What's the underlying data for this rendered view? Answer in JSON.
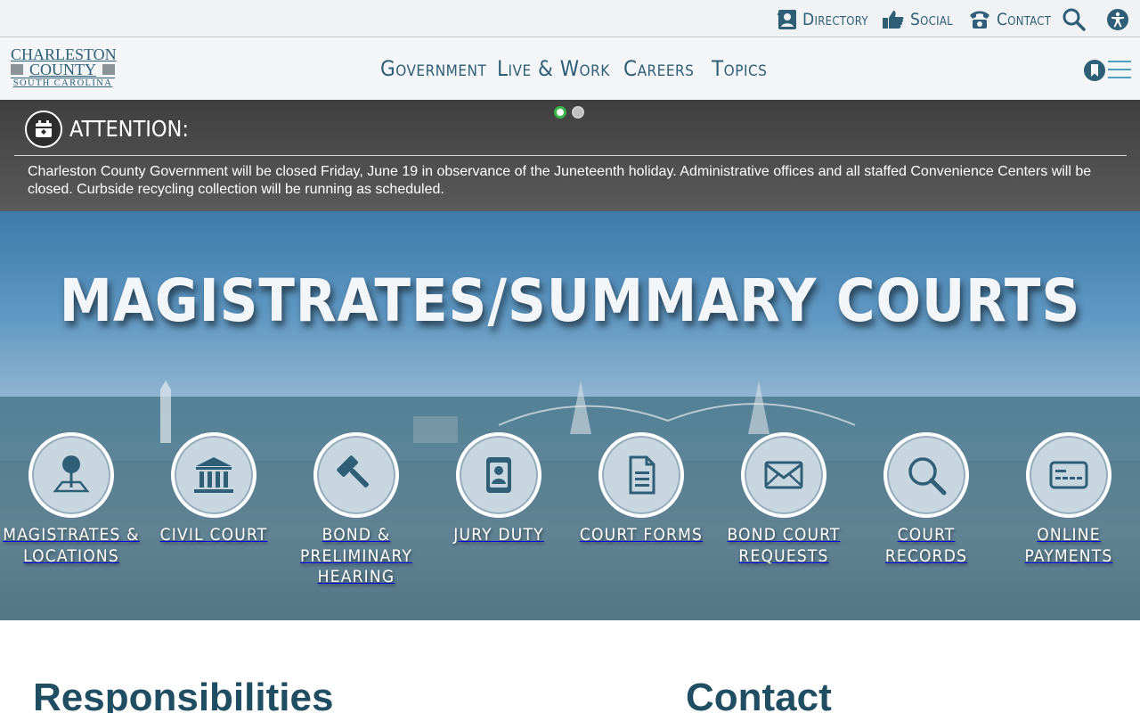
{
  "utility_bar": {
    "directory": "Directory",
    "social": "Social",
    "contact": "Contact"
  },
  "logo": {
    "line1": "CHARLESTON",
    "line2": "COUNTY",
    "line3": "SOUTH CAROLINA"
  },
  "main_nav": [
    "Government",
    "Live & Work",
    "Careers",
    "Topics"
  ],
  "alert": {
    "title": "ATTENTION:",
    "text": "Charleston County Government will be closed Friday, June 19 in observance of the Juneteenth holiday. Administrative offices and all staffed Convenience Centers will be closed. Curbside recycling collection will be running as scheduled.",
    "slides": 2,
    "active_slide": 1
  },
  "hero": {
    "title": "MAGISTRATES/SUMMARY COURTS",
    "tiles": [
      {
        "label": "Magistrates & Locations",
        "icon": "map-pin-icon"
      },
      {
        "label": "Civil Court",
        "icon": "courthouse-icon"
      },
      {
        "label": "Bond & Preliminary Hearing",
        "icon": "gavel-icon"
      },
      {
        "label": "Jury Duty",
        "icon": "id-badge-icon"
      },
      {
        "label": "Court Forms",
        "icon": "document-icon"
      },
      {
        "label": "Bond Court Requests",
        "icon": "envelope-icon"
      },
      {
        "label": "Court Records",
        "icon": "search-icon"
      },
      {
        "label": "Online Payments",
        "icon": "credit-card-icon"
      }
    ]
  },
  "content": {
    "left_heading": "Responsibilities",
    "right_heading": "Contact"
  },
  "colors": {
    "brand": "#2f5f77",
    "alert_bg": "#4a4a4a",
    "active_dot": "#3cb54a"
  }
}
